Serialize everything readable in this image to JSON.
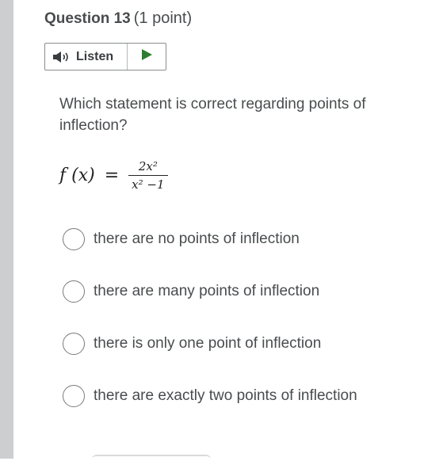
{
  "question": {
    "title": "Question 13",
    "points": "(1 point)"
  },
  "listen": {
    "label": "Listen",
    "speaker_icon": "speaker-icon",
    "play_icon": "play-icon",
    "accent_color": "#2e7d32"
  },
  "prompt": "Which statement is correct regarding points of inflection?",
  "formula": {
    "lhs": "f (x)",
    "equals": "=",
    "numerator": "2x²",
    "denominator": "x² −1"
  },
  "options": [
    {
      "label": "there are no points of inflection",
      "selected": false
    },
    {
      "label": "there are many points of inflection",
      "selected": false
    },
    {
      "label": "there is only one point of inflection",
      "selected": false
    },
    {
      "label": "there are exactly two points of inflection",
      "selected": false
    }
  ]
}
